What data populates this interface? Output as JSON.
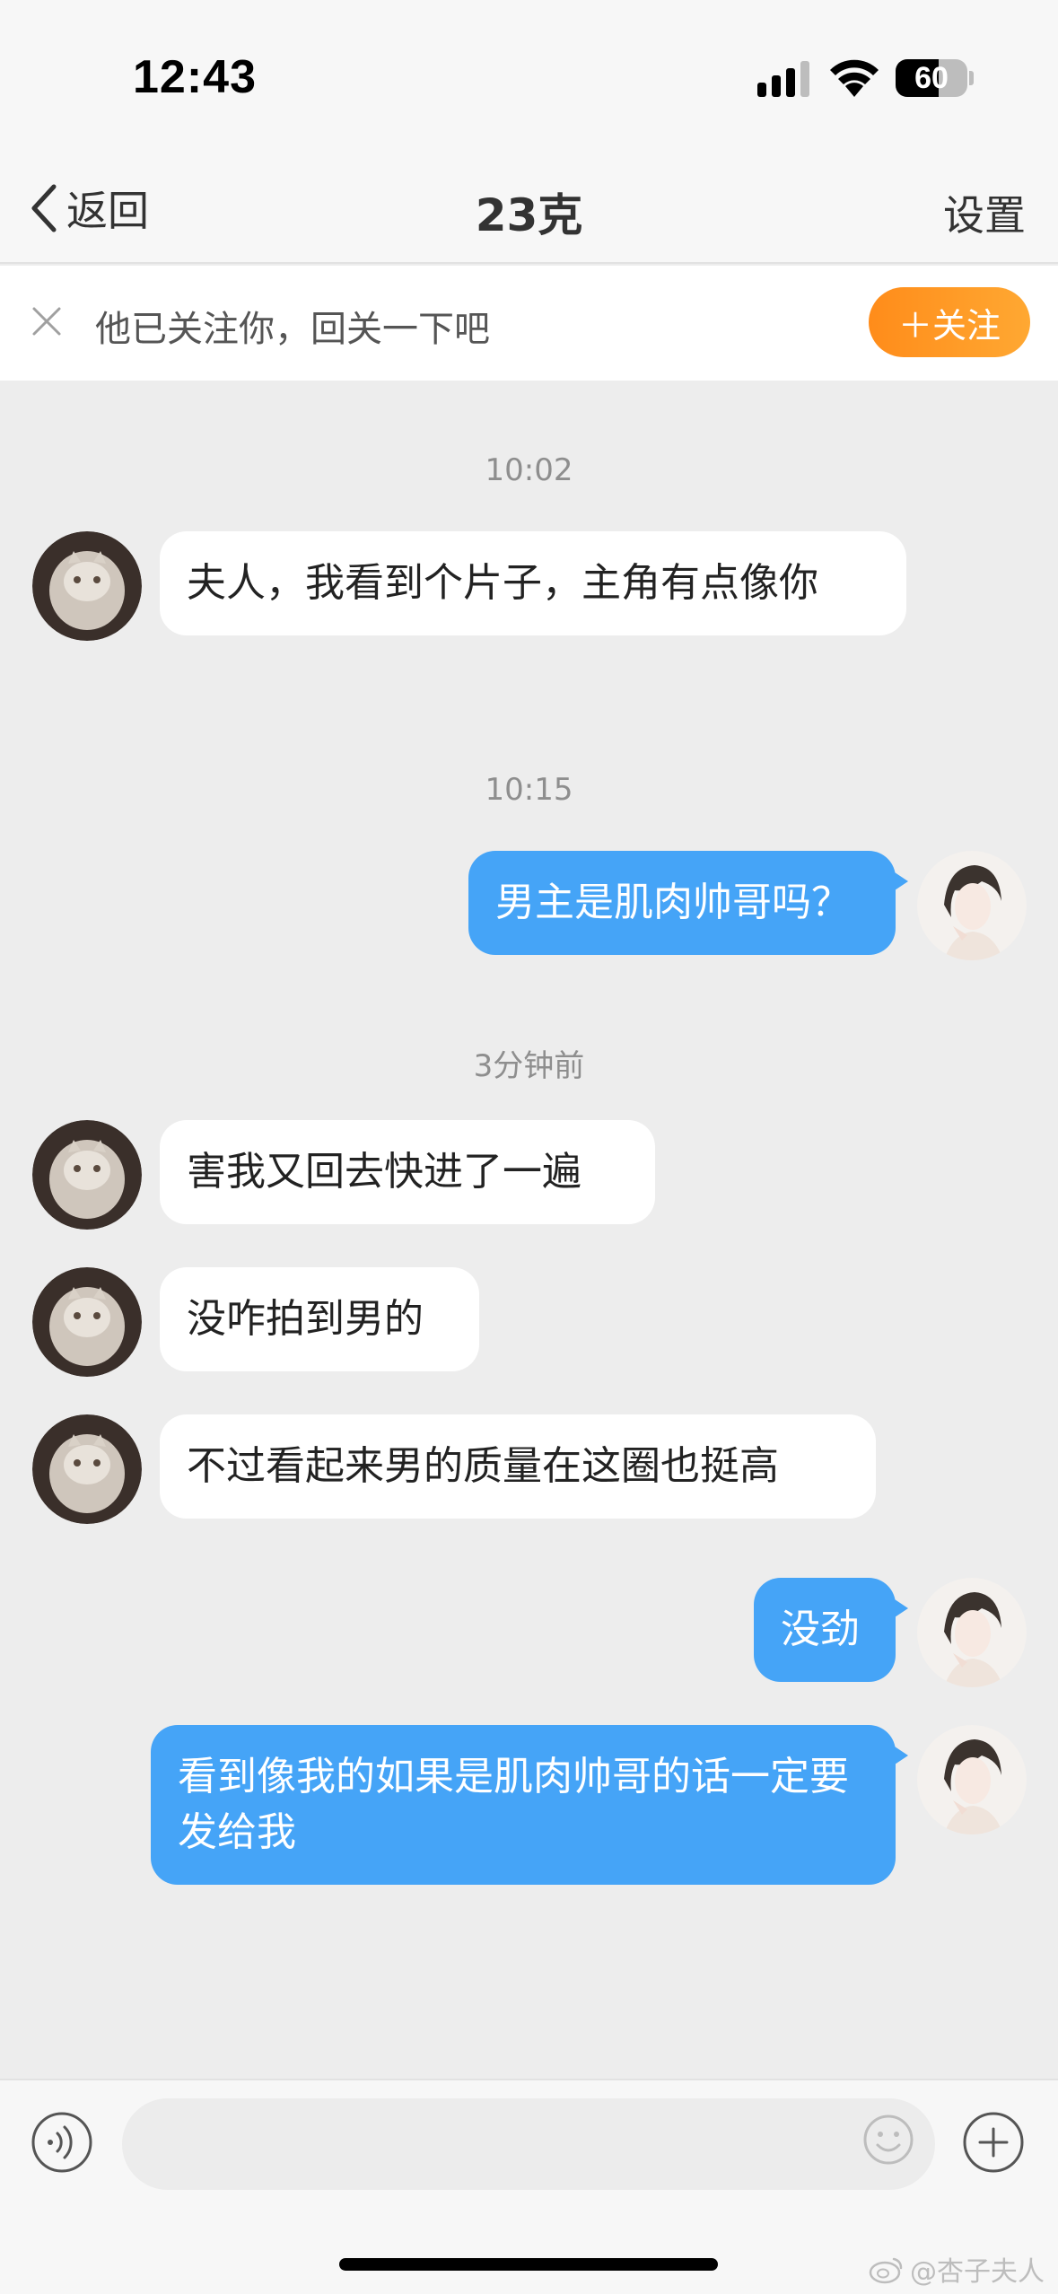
{
  "status": {
    "time": "12:43",
    "battery_level": "60",
    "battery_fraction": 0.6
  },
  "nav": {
    "back_label": "返回",
    "title": "23克",
    "settings_label": "设置"
  },
  "follow_banner": {
    "text": "他已关注你，回关一下吧",
    "button_label": "＋关注",
    "button_color": "#ff9a22"
  },
  "messages": [
    {
      "type": "time",
      "text": "10:02"
    },
    {
      "type": "in",
      "text": "夫人，我看到个片子，主角有点像你",
      "avatar": "cat-avatar-icon"
    },
    {
      "type": "time",
      "text": "10:15"
    },
    {
      "type": "out",
      "text": "男主是肌肉帅哥吗？",
      "avatar": "girl-avatar-icon"
    },
    {
      "type": "time",
      "text": "3分钟前"
    },
    {
      "type": "in",
      "text": "害我又回去快进了一遍",
      "avatar": "cat-avatar-icon"
    },
    {
      "type": "in",
      "text": "没咋拍到男的",
      "avatar": "cat-avatar-icon"
    },
    {
      "type": "in",
      "text": "不过看起来男的质量在这圈也挺高",
      "avatar": "cat-avatar-icon"
    },
    {
      "type": "out",
      "text": "没劲",
      "avatar": "girl-avatar-icon"
    },
    {
      "type": "out",
      "text": "看到像我的如果是肌肉帅哥的话一定要发给我",
      "avatar": "girl-avatar-icon"
    }
  ],
  "colors": {
    "outgoing_bubble": "#45a4f7",
    "incoming_bubble": "#ffffff",
    "chat_background": "#ededed"
  },
  "input_bar": {
    "placeholder": "",
    "value": ""
  },
  "watermark": "@杏子夫人"
}
